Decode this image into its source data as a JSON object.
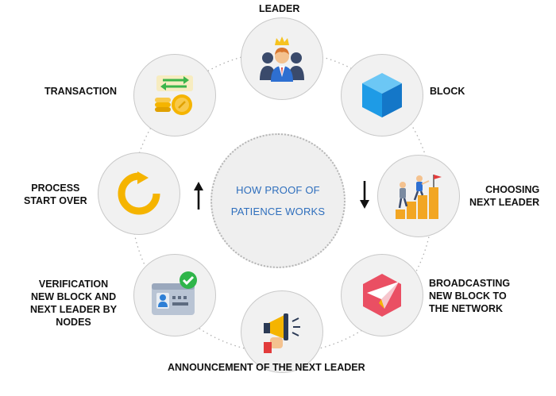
{
  "center": {
    "line1": "HOW PROOF OF",
    "line2": "PATIENCE WORKS"
  },
  "steps": [
    {
      "label": "LEADER",
      "icon": "leader-crown-icon"
    },
    {
      "label": "BLOCK",
      "icon": "cube-block-icon"
    },
    {
      "label": "CHOOSING\nNEXT LEADER",
      "icon": "climbing-podium-icon"
    },
    {
      "label": "BROADCASTING\nNEW BLOCK TO\nTHE NETWORK",
      "icon": "paper-plane-icon"
    },
    {
      "label": "ANNOUNCEMENT OF THE NEXT LEADER",
      "icon": "megaphone-icon"
    },
    {
      "label": "VERIFICATION\nNEW BLOCK AND\nNEXT LEADER BY\nNODES",
      "icon": "verified-id-card-icon"
    },
    {
      "label": "PROCESS\nSTART OVER",
      "icon": "restart-arrow-icon"
    },
    {
      "label": "TRANSACTION",
      "icon": "exchange-coins-icon"
    }
  ],
  "arrows": {
    "right": "down-arrow-icon",
    "left": "up-arrow-icon"
  },
  "colors": {
    "center_text": "#2f6fbd",
    "node_fill": "#f1f1f1",
    "ring_dots": "#b0b0b0",
    "block_blue": "#1e9be6",
    "restart_yellow": "#f5b400",
    "plane_red": "#ea4f63"
  }
}
